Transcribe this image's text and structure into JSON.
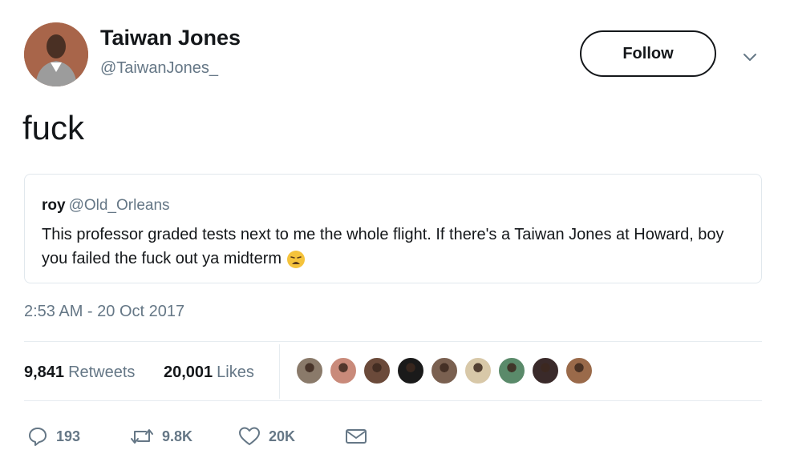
{
  "author": {
    "display_name": "Taiwan Jones",
    "handle": "@TaiwanJones_",
    "avatar_icon": "user-photo-avatar"
  },
  "follow_label": "Follow",
  "menu_icon": "chevron-down-icon",
  "tweet": {
    "text": "fuck",
    "timestamp": "2:53 AM - 20 Oct 2017"
  },
  "quoted_tweet": {
    "name": "roy",
    "handle": "@Old_Orleans",
    "text": "This professor graded tests next to me the whole flight. If there's a Taiwan Jones at Howard, boy you failed the fuck out ya midterm",
    "emoji_icon": "weary-face-emoji"
  },
  "stats": {
    "retweets_count": "9,841",
    "retweets_label": "Retweets",
    "likes_count": "20,001",
    "likes_label": "Likes"
  },
  "likers": [
    {
      "icon": "liker-avatar-1",
      "color": "#8a7a6a"
    },
    {
      "icon": "liker-avatar-2",
      "color": "#c98a7a"
    },
    {
      "icon": "liker-avatar-3",
      "color": "#6b4a3a"
    },
    {
      "icon": "liker-avatar-4",
      "color": "#1a1a1a"
    },
    {
      "icon": "liker-avatar-5",
      "color": "#7a6050"
    },
    {
      "icon": "liker-avatar-6",
      "color": "#d8c8a8"
    },
    {
      "icon": "liker-avatar-7",
      "color": "#5a8a6a"
    },
    {
      "icon": "liker-avatar-8",
      "color": "#3a2a2a"
    },
    {
      "icon": "liker-avatar-9",
      "color": "#9a6a4a"
    }
  ],
  "actions": {
    "reply_count": "193",
    "retweet_count": "9.8K",
    "like_count": "20K"
  },
  "colors": {
    "text": "#14171a",
    "secondary": "#657786",
    "border": "#e1e8ed"
  }
}
